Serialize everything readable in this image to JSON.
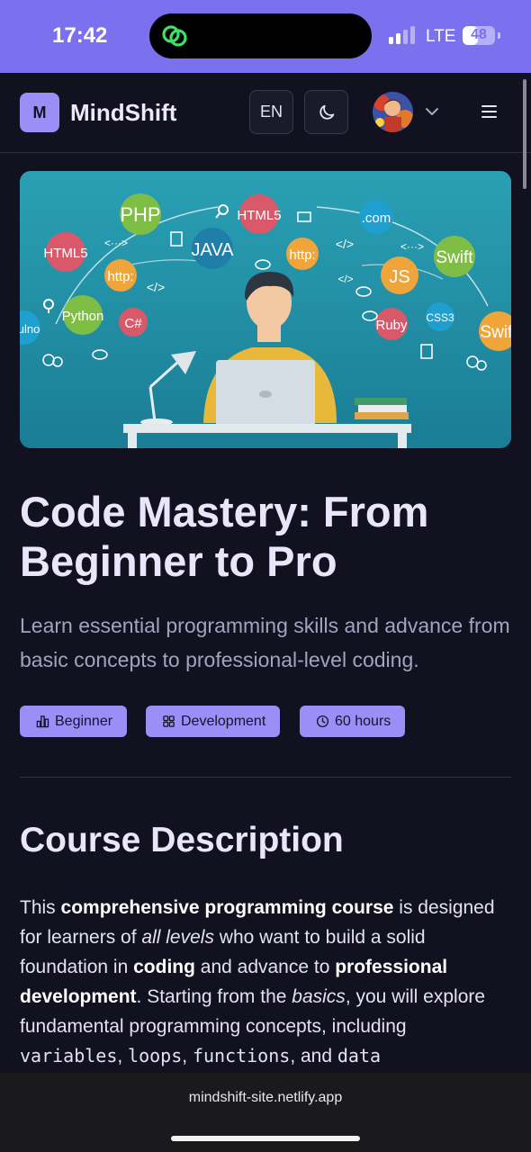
{
  "status": {
    "time": "17:42",
    "network": "LTE",
    "battery": "48",
    "battery_level": 0.48
  },
  "header": {
    "logo_letter": "M",
    "brand": "MindShift",
    "language": "EN",
    "theme_icon": "moon-icon",
    "menu_icon": "hamburger-menu-icon"
  },
  "hero": {
    "bubbles": [
      "PHP",
      "HTML5",
      "JAVA",
      "http:",
      ".com",
      "Swift",
      "HTML5",
      "http:",
      "JS",
      "Python",
      "C#",
      "Ruby",
      "CSS3",
      "Swift",
      "ulno",
      "</>",
      "<···>",
      "</>",
      "</>",
      "<···>"
    ]
  },
  "course": {
    "title": "Code Mastery: From Beginner to Pro",
    "subtitle": "Learn essential programming skills and advance from basic concepts to professional-level coding.",
    "tags": [
      {
        "label": "Beginner",
        "icon": "bar-chart-icon"
      },
      {
        "label": "Development",
        "icon": "grid-icon"
      },
      {
        "label": "60 hours",
        "icon": "clock-icon"
      }
    ]
  },
  "description": {
    "heading": "Course Description",
    "p1": "This ",
    "b1": "comprehensive programming course",
    "p2": " is designed for learners of ",
    "i1": "all levels",
    "p3": " who want to build a solid foundation in ",
    "b2": "coding",
    "p4": " and advance to ",
    "b3": "professional development",
    "p5": ". Starting from the ",
    "i2": "basics",
    "p6": ", you will explore fundamental programming concepts, including ",
    "c1": "variables",
    "s1": ", ",
    "c2": "loops",
    "s2": ", ",
    "c3": "functions",
    "s3": ", and ",
    "c4": "data"
  },
  "browser": {
    "url": "mindshift-site.netlify.app"
  },
  "colors": {
    "status_bar": "#7b70ee",
    "accent": "#9d8df7",
    "background": "#121120"
  }
}
